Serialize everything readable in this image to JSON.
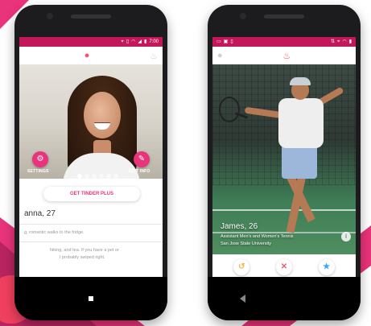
{
  "colors": {
    "brand_pink": "#e9337a",
    "brand_red": "#fd5068",
    "status_bar": "#c2185b",
    "undo_yellow": "#f5b748",
    "nope_red": "#ec5e6f",
    "superlike_blue": "#3ca4ff"
  },
  "left_phone": {
    "status_time": "7:00",
    "status_icons": [
      "location-icon",
      "vibrate-icon",
      "wifi-icon",
      "signal-icon",
      "battery-icon"
    ],
    "nav": {
      "active": "profile-icon",
      "idle": "flame-icon"
    },
    "settings_label": "SETTINGS",
    "edit_info_label": "EDIT INFO",
    "photo_dots": 6,
    "photo_dot_active": 1,
    "plus_button_label": "GET TINDER PLUS",
    "profile_name": "anna, 27",
    "bio_line_1": "g, romantic walks to the fridge.",
    "bio_line_2": "hiking, and tea. If you have a pet or",
    "bio_line_3": "I probably swiped right."
  },
  "right_phone": {
    "status_icons_left": [
      "message-icon",
      "image-icon",
      "clipboard-icon"
    ],
    "status_icons_right": [
      "network-icon",
      "location-icon",
      "wifi-icon",
      "battery-icon"
    ],
    "nav": {
      "active": "flame-icon",
      "idle": "profile-icon"
    },
    "match_name": "James, 26",
    "match_job": "Assistant Men's and Women's Tennis",
    "match_school": "San Jose State University",
    "actions": [
      {
        "name": "undo-button",
        "glyph": "↺"
      },
      {
        "name": "nope-button",
        "glyph": "✕"
      },
      {
        "name": "superlike-button",
        "glyph": "★"
      }
    ]
  }
}
